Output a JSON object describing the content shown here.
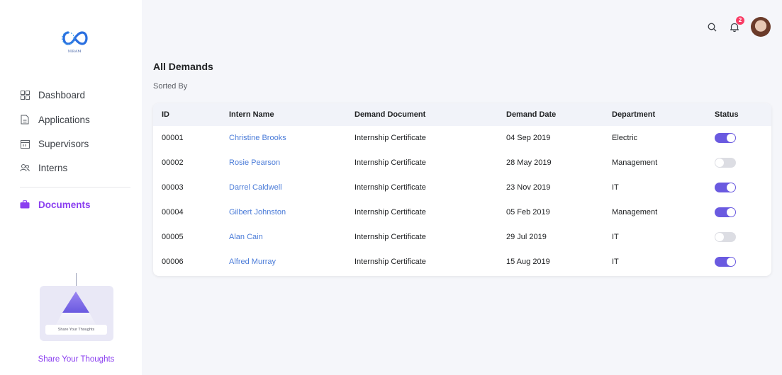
{
  "logo": {
    "text": "NIRAM"
  },
  "sidebar": {
    "items": [
      {
        "label": "Dashboard",
        "icon": "grid-icon"
      },
      {
        "label": "Applications",
        "icon": "file-icon"
      },
      {
        "label": "Supervisors",
        "icon": "calendar-icon"
      },
      {
        "label": "Interns",
        "icon": "users-icon"
      },
      {
        "label": "Documents",
        "icon": "briefcase-icon",
        "active": true
      }
    ]
  },
  "promo": {
    "button_label": "Share Your Thoughts",
    "link_label": "Share Your Thoughts"
  },
  "topbar": {
    "notification_count": "2"
  },
  "main": {
    "title": "All Demands",
    "sorted_by": "Sorted By",
    "columns": [
      "ID",
      "Intern Name",
      "Demand Document",
      "Demand Date",
      "Department",
      "Status"
    ],
    "rows": [
      {
        "id": "00001",
        "name": "Christine Brooks",
        "document": "Internship Certificate",
        "date": "04 Sep 2019",
        "department": "Electric",
        "status": true
      },
      {
        "id": "00002",
        "name": "Rosie Pearson",
        "document": "Internship Certificate",
        "date": "28 May 2019",
        "department": "Management",
        "status": false
      },
      {
        "id": "00003",
        "name": "Darrel Caldwell",
        "document": "Internship Certificate",
        "date": "23 Nov 2019",
        "department": "IT",
        "status": true
      },
      {
        "id": "00004",
        "name": "Gilbert Johnston",
        "document": "Internship Certificate",
        "date": "05 Feb 2019",
        "department": "Management",
        "status": true
      },
      {
        "id": "00005",
        "name": "Alan Cain",
        "document": "Internship Certificate",
        "date": "29 Jul 2019",
        "department": "IT",
        "status": false
      },
      {
        "id": "00006",
        "name": "Alfred Murray",
        "document": "Internship Certificate",
        "date": "15 Aug 2019",
        "department": "IT",
        "status": true
      }
    ]
  },
  "colors": {
    "accent": "#8b3ff0",
    "toggle_on": "#6a5ae0",
    "link": "#4a7bd8",
    "badge": "#f93c65"
  }
}
